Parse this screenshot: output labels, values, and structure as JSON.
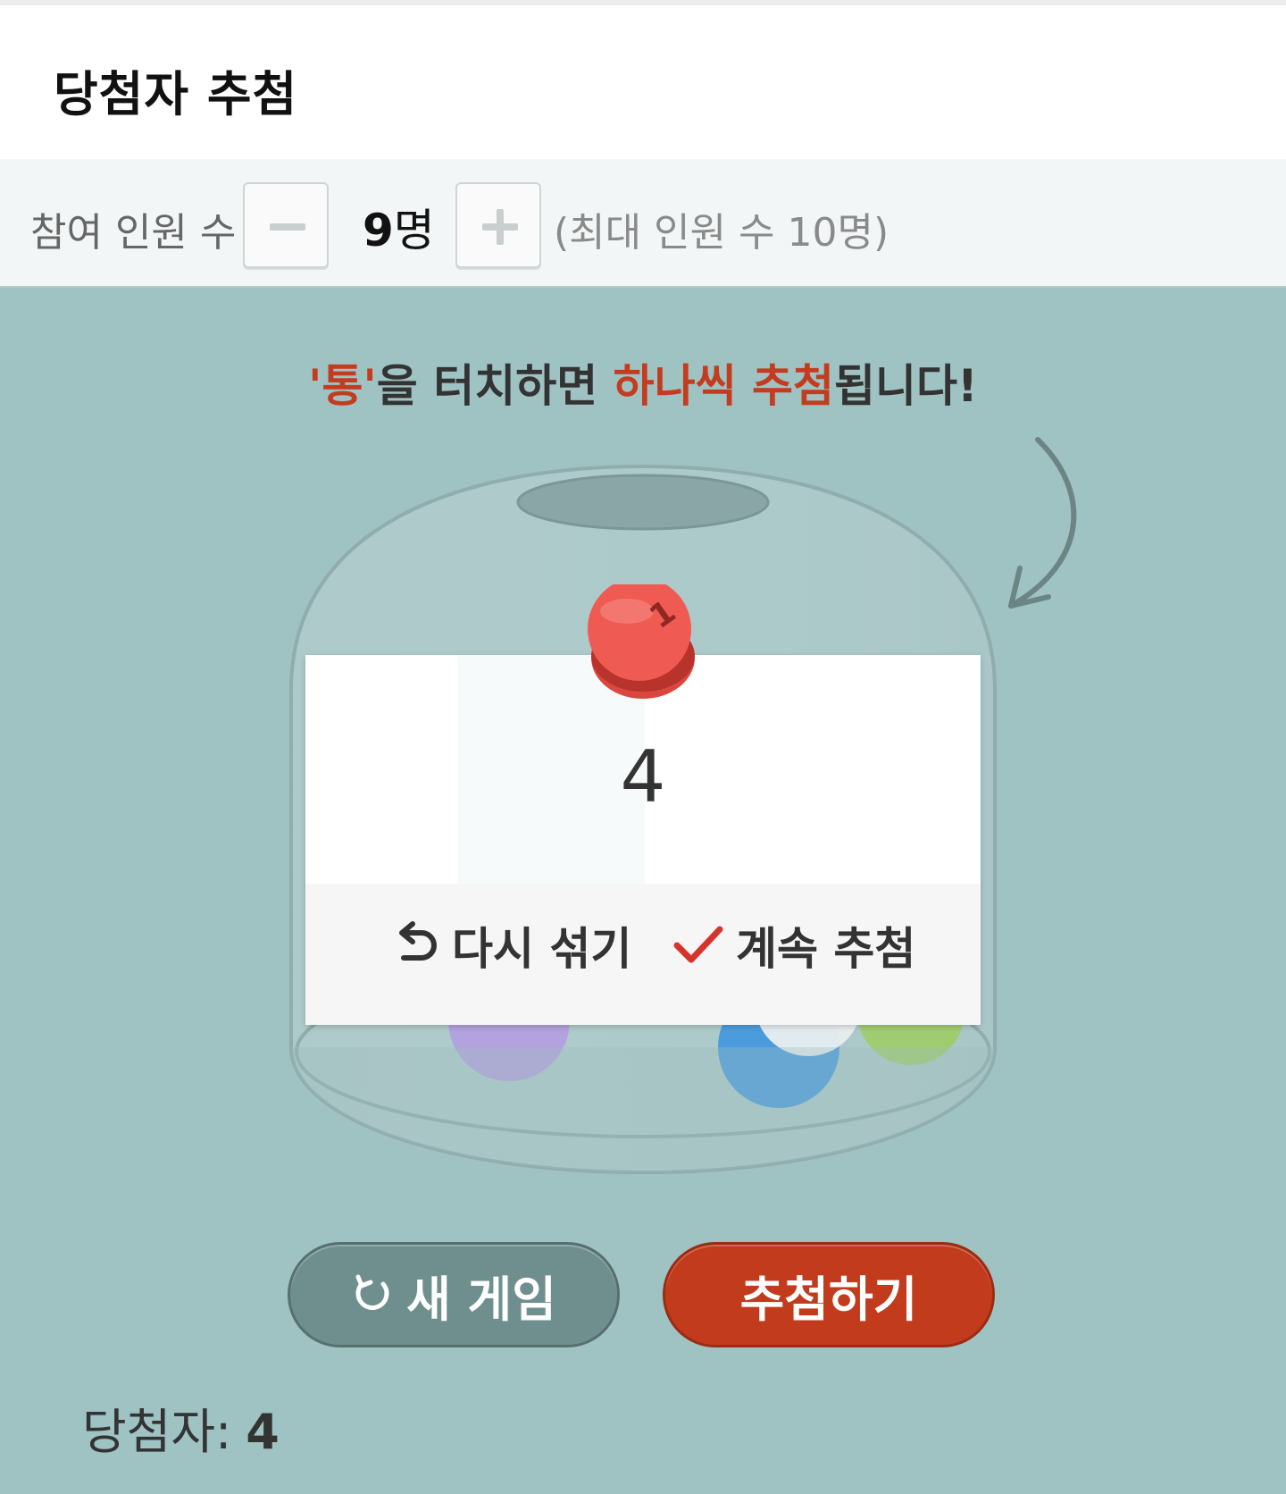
{
  "header": {
    "title": "당첨자 추첨"
  },
  "controls": {
    "label": "참여 인원 수",
    "count_value": "9",
    "count_unit": "명",
    "max_info": "(최대 인원 수 10명)"
  },
  "instruction": {
    "part1": "'통'",
    "part2": "을 터치하면 ",
    "part3": "하나씩 추첨",
    "part4": "됩니다!"
  },
  "result_dialog": {
    "drawn_number": "4",
    "ball_label": "1",
    "reshuffle_label": "다시 섞기",
    "continue_label": "계속 추첨"
  },
  "buttons": {
    "new_game_label": "새 게임",
    "draw_label": "추첨하기"
  },
  "winner": {
    "label": "당첨자:",
    "value": "4"
  },
  "colors": {
    "background": "#9fc2c2",
    "accent_red": "#c43c1f",
    "new_game_button": "#6f8f8f",
    "draw_button": "#c23b1d"
  },
  "icons": [
    "undo-arrow-icon",
    "check-icon",
    "refresh-icon",
    "curved-arrow-icon"
  ]
}
